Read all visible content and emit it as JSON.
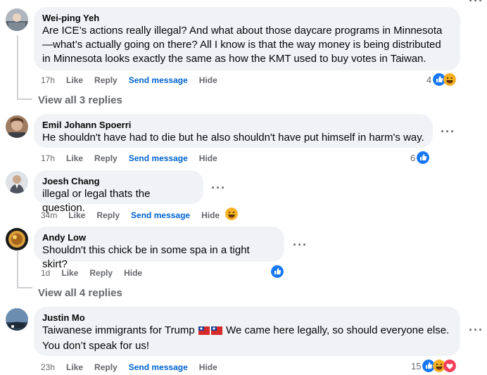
{
  "comments": [
    {
      "author": "Wei-ping Yeh",
      "text": "Are ICE’s actions really illegal? And what about those daycare programs in Minnesota—what’s actually going on there? All I know is that the way money is being distributed in Minnesota looks exactly the same as how the KMT used to buy votes in Taiwan.",
      "time": "17h",
      "like": "Like",
      "reply": "Reply",
      "send": "Send message",
      "hide": "Hide",
      "reaction_count": "4",
      "reactions": [
        "like-icon",
        "haha-icon"
      ]
    },
    {
      "author": "Emil Johann Spoerri",
      "text": "He shouldn't have had to die but he also shouldn't have put himself in harm's way.",
      "time": "17h",
      "like": "Like",
      "reply": "Reply",
      "send": "Send message",
      "hide": "Hide",
      "reaction_count": "6",
      "reactions": [
        "like-icon"
      ]
    },
    {
      "author": "Joesh Chang",
      "text": "illegal or legal thats the question.",
      "time": "34m",
      "like": "Like",
      "reply": "Reply",
      "send": "Send message",
      "hide": "Hide",
      "reactions": [
        "haha-icon"
      ]
    },
    {
      "author": "Andy Low",
      "text": "Shouldn't this chick be in some spa in a tight skirt?",
      "time": "1d",
      "like": "Like",
      "reply": "Reply",
      "hide": "Hide",
      "reactions": [
        "like-icon"
      ]
    },
    {
      "author": "Justin Mo",
      "text_before_flags": "Taiwanese immigrants for Trump",
      "text_after_flags": "We came here legally, so should everyone else.",
      "text_line2": "You don’t speak for us!",
      "flags": [
        "taiwan-flag-icon",
        "taiwan-flag-icon"
      ],
      "time": "23h",
      "like": "Like",
      "reply": "Reply",
      "send": "Send message",
      "hide": "Hide",
      "reaction_count": "15",
      "reactions": [
        "like-icon",
        "haha-icon",
        "love-icon"
      ]
    }
  ],
  "view_replies": [
    "View all 3 replies",
    "View all 4 replies"
  ],
  "colors": {
    "bubble": "#f0f2f5",
    "meta": "#65676b",
    "link": "#0064d1",
    "like": "#1877f2",
    "haha": "#f7b125",
    "love": "#f33e58"
  }
}
